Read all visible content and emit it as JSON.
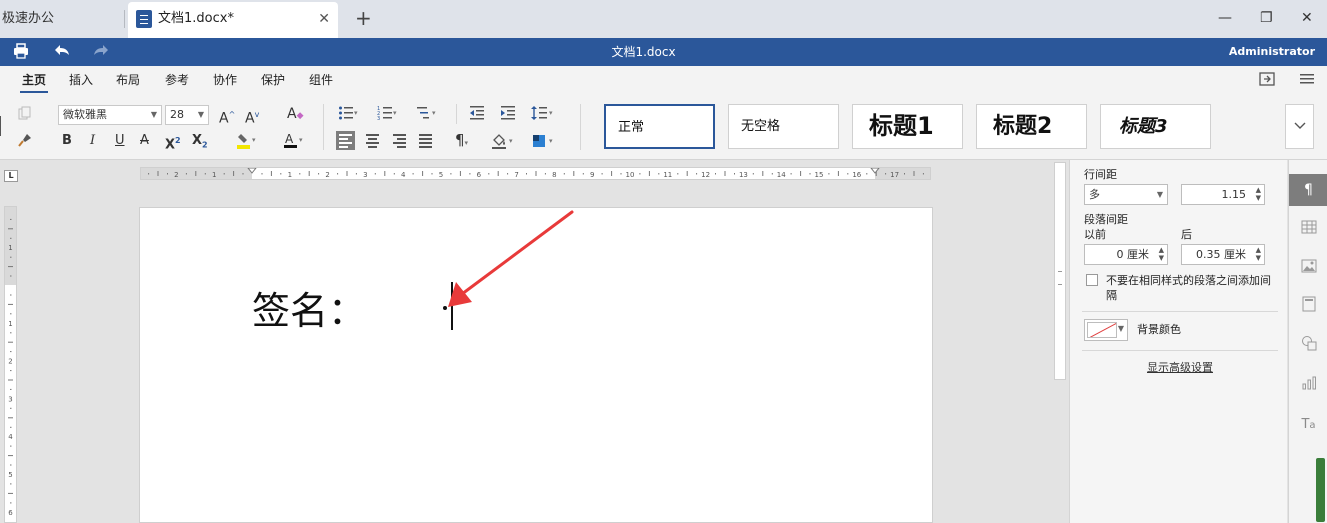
{
  "tabs": {
    "home_label": "极速办公",
    "doc_label": "文档1.docx*",
    "close_symbol": "✕",
    "add_symbol": "+"
  },
  "window": {
    "minimize": "—",
    "restore": "❐",
    "close": "✕"
  },
  "titlebar": {
    "title": "文档1.docx",
    "user": "Administrator"
  },
  "menu": {
    "items": [
      "主页",
      "插入",
      "布局",
      "参考",
      "协作",
      "保护",
      "组件"
    ],
    "active": "主页"
  },
  "ribbon": {
    "font_name": "微软雅黑",
    "font_size": "28",
    "styles": [
      "正常",
      "无空格",
      "标题1",
      "标题2",
      "标题3"
    ],
    "selected_style": "正常"
  },
  "document": {
    "signature_label": "签名："
  },
  "panel": {
    "line_spacing_label": "行间距",
    "line_spacing_mode": "多",
    "line_spacing_value": "1.15",
    "paragraph_spacing_label": "段落间距",
    "before_label": "以前",
    "after_label": "后",
    "before_value": "0 厘米",
    "after_value": "0.35 厘米",
    "no_space_checkbox_label": "不要在相同样式的段落之间添加间隔",
    "background_color_label": "背景颜色",
    "advanced_settings_link": "显示高级设置"
  },
  "ruler": {
    "h_labels": [
      "2",
      "1",
      "1",
      "2",
      "3",
      "4",
      "5",
      "6",
      "7",
      "8",
      "9",
      "10",
      "11",
      "12",
      "13",
      "14",
      "15",
      "16",
      "17"
    ],
    "v_labels": [
      "1",
      "1",
      "2",
      "3",
      "4",
      "5",
      "6"
    ]
  },
  "colors": {
    "brand": "#2b579a",
    "annotation_arrow": "#e83a3a",
    "selected_tool_bg": "#7d7d7d"
  }
}
